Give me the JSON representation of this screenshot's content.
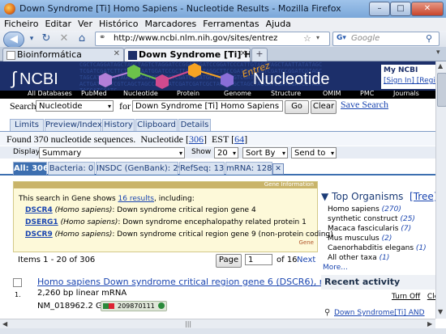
{
  "window": {
    "title": "Down Syndrome [Ti] Homo Sapiens - Nucleotide Results - Mozilla Firefox"
  },
  "menu": [
    "Ficheiro",
    "Editar",
    "Ver",
    "Histórico",
    "Marcadores",
    "Ferramentas",
    "Ajuda"
  ],
  "toolbar": {
    "url": "http://www.ncbi.nlm.nih.gov/sites/entrez",
    "search_engine": "Google",
    "search_placeholder": "Google"
  },
  "tabs": [
    {
      "label": "Bioinformática"
    },
    {
      "label": "Down Syndrome [Ti] Hom..."
    }
  ],
  "ncbi": {
    "logo": "NCBI",
    "db_title": "Nucleotide",
    "entrez": "Entrez",
    "myncbi": {
      "title": "My NCBI",
      "links": "[Sign In] [Regist"
    },
    "nav": [
      "All Databases",
      "PubMed",
      "Nucleotide",
      "Protein",
      "Genome",
      "Structure",
      "OMIM",
      "PMC",
      "Journals"
    ]
  },
  "search": {
    "label": "Search",
    "db": "Nucleotide",
    "for_label": "for",
    "term": "Down Syndrome [Ti] Homo Sapiens",
    "go": "Go",
    "clear": "Clear",
    "save": "Save Search"
  },
  "tool_tabs": [
    "Limits",
    "Preview/Index",
    "History",
    "Clipboard",
    "Details"
  ],
  "found": {
    "text": "Found 370 nucleotide sequences.",
    "nucleotide_label": "Nucleotide",
    "nucleotide_count": "306",
    "est_label": "EST",
    "est_count": "64"
  },
  "display": {
    "label": "Display",
    "value": "Summary",
    "show_label": "Show",
    "show_value": "20",
    "sort_by": "Sort By",
    "send_to": "Send to"
  },
  "filter_tabs": [
    "All: 306",
    "Bacteria: 0",
    "INSDC (GenBank): 293",
    "RefSeq: 13",
    "mRNA: 128"
  ],
  "gene_info": {
    "header": "Gene Information",
    "intro_prefix": "This search in Gene shows",
    "intro_link": "16 results",
    "intro_suffix": ", including:",
    "items": [
      {
        "symbol": "DSCR4",
        "species": "(Homo sapiens)",
        "desc": ": Down syndrome critical region gene 4"
      },
      {
        "symbol": "DSERG1",
        "species": "(Homo sapiens)",
        "desc": ": Down syndrome encephalopathy related protein 1"
      },
      {
        "symbol": "DSCR9",
        "species": "(Homo sapiens)",
        "desc": ": Down syndrome critical region gene 9 (non-protein coding)"
      }
    ],
    "footer": "Gene"
  },
  "paging": {
    "items": "Items 1 - 20 of 306",
    "page_btn": "Page",
    "page_value": "1",
    "of": "of 16",
    "next": "Next"
  },
  "result": {
    "num": "1.",
    "title": "Homo sapiens Down syndrome critical region gene 6 (DSCR6), mRNA",
    "desc": "2,260 bp linear mRNA",
    "accession": "NM_018962.2  GI:",
    "gi": "209870111"
  },
  "organisms": {
    "title": "Top Organisms",
    "tree": "[Tree]",
    "items": [
      {
        "name": "Homo sapiens",
        "count": "(270)"
      },
      {
        "name": "synthetic construct",
        "count": "(25)"
      },
      {
        "name": "Macaca fascicularis",
        "count": "(7)"
      },
      {
        "name": "Mus musculus",
        "count": "(2)"
      },
      {
        "name": "Caenorhabditis elegans",
        "count": "(1)"
      },
      {
        "name": "All other taxa",
        "count": "(1)"
      }
    ],
    "more": "More..."
  },
  "recent": {
    "title": "Recent activity",
    "turn_off": "Turn Off",
    "clear": "Clear",
    "item": "Down Syndrome[Ti] AND"
  }
}
